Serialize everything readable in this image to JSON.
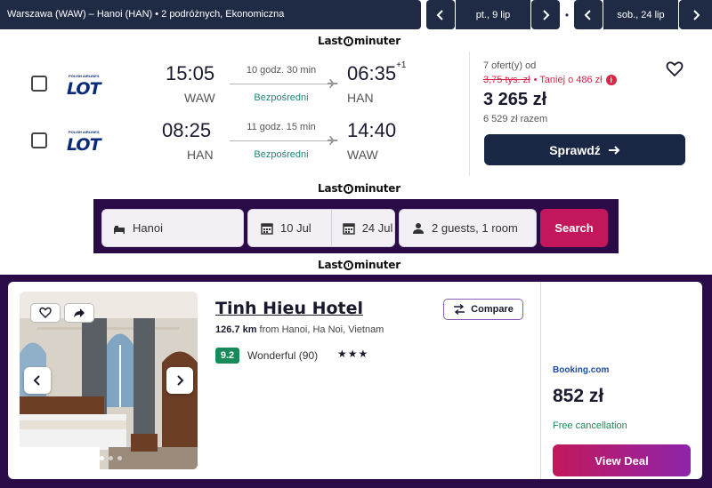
{
  "flight_search": {
    "route_summary": "Warszawa (WAW) – Hanoi (HAN)  •  2 podróżnych, Ekonomiczna",
    "depart_date": "pt., 9 lip",
    "return_date": "sob., 24 lip",
    "separator": "•"
  },
  "brand": {
    "logo_left": "Last",
    "logo_right": "minuter"
  },
  "flight": {
    "outbound": {
      "depart_time": "15:05",
      "depart_code": "WAW",
      "duration": "10 godz. 30 min",
      "stops": "Bezpośredni",
      "arrive_time": "06:35",
      "day_offset": "+1",
      "arrive_code": "HAN"
    },
    "inbound": {
      "depart_time": "08:25",
      "depart_code": "HAN",
      "duration": "11 godz. 15 min",
      "stops": "Bezpośredni",
      "arrive_time": "14:40",
      "arrive_code": "WAW"
    },
    "airline": {
      "name": "LOT",
      "tagline": "POLISH AIRLINES"
    },
    "offers_label": "7 ofert(y) od",
    "old_price": "3,75 tys. zł",
    "discount": "• Taniej o 486 zł",
    "price": "3 265 zł",
    "total": "6 529 zł razem",
    "cta": "Sprawdź",
    "colors": {
      "accent_dark": "#1a2744",
      "discount_red": "#d6264a",
      "direct_green": "#1a8a7a"
    }
  },
  "hotel_search": {
    "destination": "Hanoi",
    "checkin": "10 Jul",
    "checkout": "24 Jul",
    "guests": "2 guests, 1 room",
    "search_label": "Search"
  },
  "hotel": {
    "name": "Tinh Hieu Hotel",
    "distance": "126.7 km",
    "distance_suffix": "from Hanoi, Ha Noi, Vietnam",
    "rating_score": "9.2",
    "rating_text": "Wonderful (90)",
    "stars": "★★★",
    "compare_label": "Compare",
    "provider": "Booking.com",
    "price": "852 zł",
    "cancellation": "Free cancellation",
    "cta": "View Deal",
    "colors": {
      "brand_purple": "#2a0b47",
      "cta_pink": "#c2185b",
      "rating_green": "#1b8a5a"
    }
  }
}
